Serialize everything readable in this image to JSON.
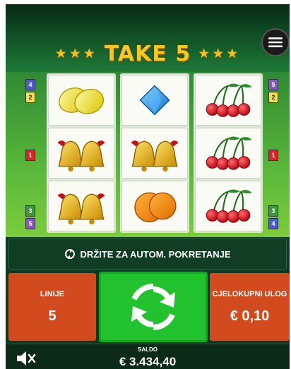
{
  "header": {
    "stars_left": "★★★",
    "title": "TAKE 5",
    "stars_right": "★★★",
    "menu_icon": "hamburger-menu-icon"
  },
  "line_markers": {
    "left": [
      "4",
      "2",
      "1",
      "3",
      "5"
    ],
    "right": [
      "5",
      "2",
      "1",
      "3",
      "4"
    ]
  },
  "reels": [
    [
      "lemon",
      "bell",
      "bell"
    ],
    [
      "diamond",
      "bell",
      "orange"
    ],
    [
      "cherry",
      "cherry",
      "cherry"
    ]
  ],
  "autoplay": {
    "label": "DRŽITE ZA AUTOM. POKRETANJE",
    "icon": "autoplay-icon"
  },
  "controls": {
    "lines_label": "LINIJE",
    "lines_value": "5",
    "spin_icon": "spin-arrows-icon",
    "total_bet_label": "CJELOKUPNI ULOG",
    "total_bet_value": "€ 0,10"
  },
  "footer": {
    "mute_icon": "speaker-muted-icon",
    "balance_label": "SALDO",
    "balance_value": "€ 3.434,40"
  },
  "colors": {
    "title_gold": "#f7c81e",
    "panel_orange": "#d24b1e",
    "spin_green": "#22c12e",
    "background_dark_green": "#0e3a22"
  }
}
